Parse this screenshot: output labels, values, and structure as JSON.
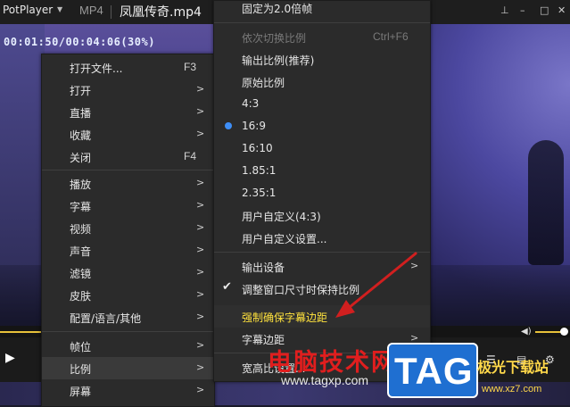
{
  "titlebar": {
    "app_name": "PotPlayer",
    "format": "MP4",
    "file_title": "凤凰传奇.mp4",
    "controls": [
      "pin-icon",
      "minimize-icon",
      "maximize-icon",
      "close-icon"
    ]
  },
  "osd": {
    "time": "00:01:50/00:04:06(30%)"
  },
  "playback": {
    "progress_fraction": 0.3
  },
  "main_menu": [
    {
      "label": "打开文件...",
      "shortcut": "F3",
      "arrow": ""
    },
    {
      "label": "打开",
      "shortcut": "",
      "arrow": ">"
    },
    {
      "label": "直播",
      "shortcut": "",
      "arrow": ">"
    },
    {
      "label": "收藏",
      "shortcut": "",
      "arrow": ">"
    },
    {
      "label": "关闭",
      "shortcut": "F4",
      "arrow": ""
    },
    {
      "label": "播放",
      "shortcut": "",
      "arrow": ">"
    },
    {
      "label": "字幕",
      "shortcut": "",
      "arrow": ">"
    },
    {
      "label": "视频",
      "shortcut": "",
      "arrow": ">"
    },
    {
      "label": "声音",
      "shortcut": "",
      "arrow": ">"
    },
    {
      "label": "滤镜",
      "shortcut": "",
      "arrow": ">"
    },
    {
      "label": "皮肤",
      "shortcut": "",
      "arrow": ">"
    },
    {
      "label": "配置/语言/其他",
      "shortcut": "",
      "arrow": ">"
    },
    {
      "label": "帧位",
      "shortcut": "",
      "arrow": ">"
    },
    {
      "label": "比例",
      "shortcut": "",
      "arrow": ">"
    },
    {
      "label": "屏幕",
      "shortcut": "",
      "arrow": ">"
    }
  ],
  "sub_menu": [
    {
      "label": "固定为2.0倍帧",
      "shortcut": "",
      "arrow": ""
    },
    {
      "label": "依次切换比例",
      "shortcut": "Ctrl+F6",
      "arrow": ""
    },
    {
      "label": "输出比例(推荐)",
      "shortcut": "",
      "arrow": ""
    },
    {
      "label": "原始比例",
      "shortcut": "",
      "arrow": ""
    },
    {
      "label": "4:3",
      "shortcut": "",
      "arrow": ""
    },
    {
      "label": "16:9",
      "shortcut": "",
      "arrow": ""
    },
    {
      "label": "16:10",
      "shortcut": "",
      "arrow": ""
    },
    {
      "label": "1.85:1",
      "shortcut": "",
      "arrow": ""
    },
    {
      "label": "2.35:1",
      "shortcut": "",
      "arrow": ""
    },
    {
      "label": "用户自定义(4:3)",
      "shortcut": "",
      "arrow": ""
    },
    {
      "label": "用户自定义设置...",
      "shortcut": "",
      "arrow": ""
    },
    {
      "label": "输出设备",
      "shortcut": "",
      "arrow": ">"
    },
    {
      "label": "调整窗口尺寸时保持比例",
      "shortcut": "",
      "arrow": ""
    },
    {
      "label": "强制确保字幕边距",
      "shortcut": "",
      "arrow": ""
    },
    {
      "label": "字幕边距",
      "shortcut": "",
      "arrow": ">"
    },
    {
      "label": "宽高比设置...",
      "shortcut": "",
      "arrow": ""
    }
  ],
  "watermark": {
    "site_name": "电脑技术网",
    "site_url": "www.tagxp.com",
    "logo_text": "TAG",
    "site2_name": "极光下载站",
    "site2_url": "www.xz7.com"
  },
  "colors": {
    "accent": "#e8c23a",
    "highlight_text": "#ffe23d",
    "radio": "#3e8ef7",
    "arrow": "#d11f1f"
  }
}
